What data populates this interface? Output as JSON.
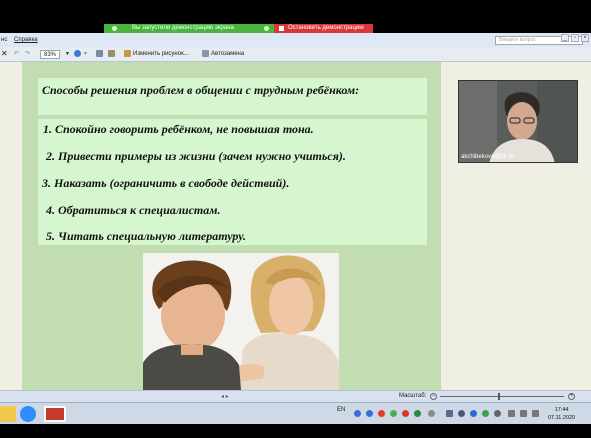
{
  "share_bar": {
    "status_text": "Вы запустили демонстрацию экрана",
    "stop_label": "Остановить демонстрацию"
  },
  "menu": {
    "items": [
      "нс",
      "Справка"
    ],
    "help_placeholder": "Введите вопрос"
  },
  "toolbar": {
    "zoom": "83%",
    "change_picture": "Изменить рисунок...",
    "autoshape": "Автозамена"
  },
  "slide": {
    "title": "Способы решения проблем в общении с трудным ребёнком:",
    "items": [
      "1. Спокойно говорить ребёнком, не повышая тона.",
      "2. Привести примеры из жизни (зачем нужно учиться).",
      "3. Наказать (ограничить в свободе действий).",
      "4. Обратиться к специалистам.",
      "5. Читать специальную литературу."
    ]
  },
  "webcam": {
    "user_email": "akchibekova@bk.ru"
  },
  "status": {
    "zoom_label": "Масштаб:"
  },
  "taskbar": {
    "lang": "EN",
    "time": "17:44",
    "date": "07.11.2020"
  },
  "colors": {
    "slide_bg": "#c3ddb2",
    "text_box_bg": "#d6f6d0",
    "share_green": "#49b53f",
    "share_red": "#d9383a"
  }
}
